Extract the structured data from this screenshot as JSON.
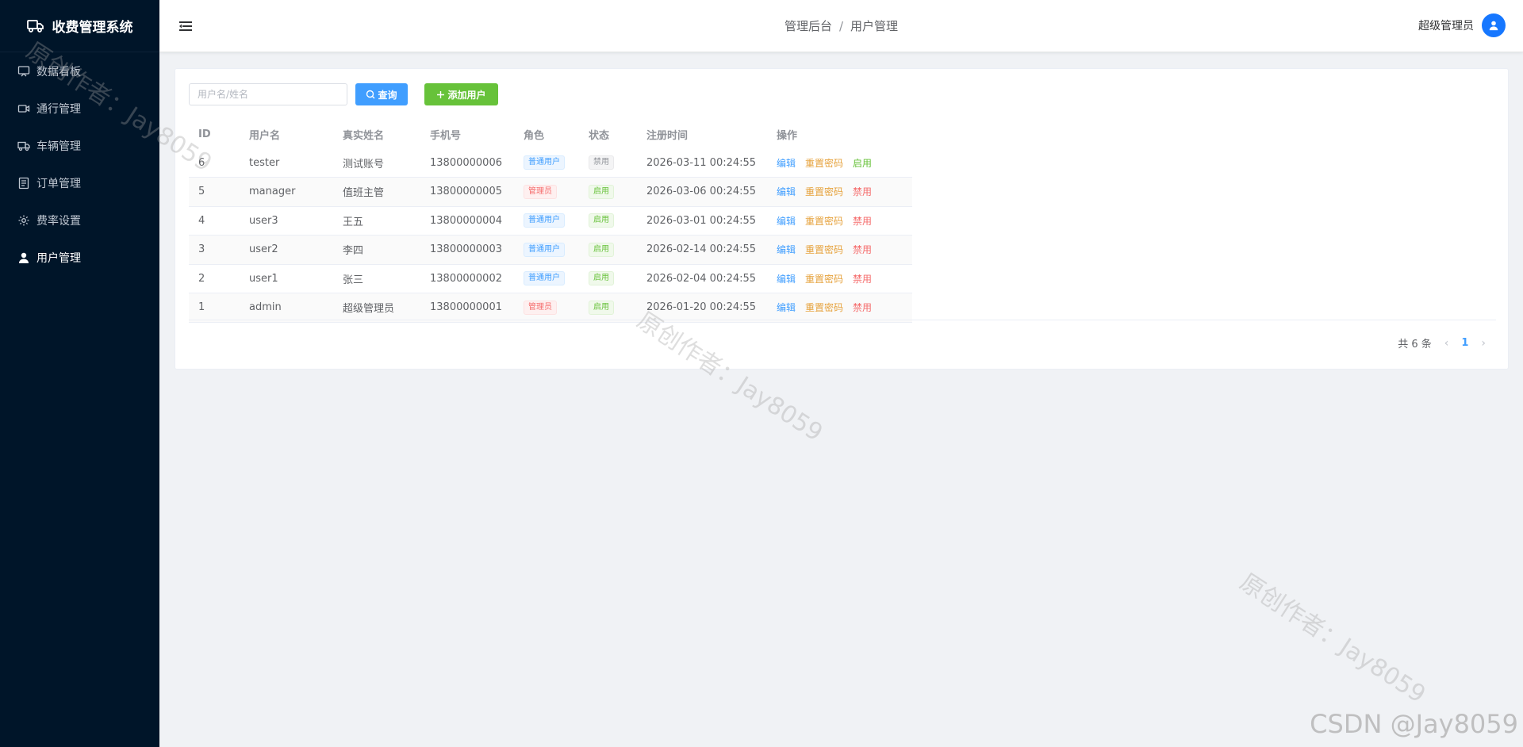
{
  "app": {
    "title": "收费管理系统"
  },
  "sidebar": {
    "items": [
      {
        "label": "数据看板",
        "icon": "dashboard-icon"
      },
      {
        "label": "通行管理",
        "icon": "camera-icon"
      },
      {
        "label": "车辆管理",
        "icon": "truck-icon"
      },
      {
        "label": "订单管理",
        "icon": "document-icon"
      },
      {
        "label": "费率设置",
        "icon": "gear-icon"
      },
      {
        "label": "用户管理",
        "icon": "user-icon",
        "active": true
      }
    ]
  },
  "header": {
    "breadcrumb": [
      "管理后台",
      "用户管理"
    ],
    "breadcrumb_sep": "/",
    "user_name": "超级管理员"
  },
  "toolbar": {
    "search_placeholder": "用户名/姓名",
    "search_value": "",
    "query_label": "查询",
    "add_label": "添加用户"
  },
  "table": {
    "columns": [
      "ID",
      "用户名",
      "真实姓名",
      "手机号",
      "角色",
      "状态",
      "注册时间",
      "操作"
    ],
    "rows": [
      {
        "id": "6",
        "username": "tester",
        "realname": "测试账号",
        "phone": "13800000006",
        "role": "普通用户",
        "status": "禁用",
        "registered": "2026-03-11 00:24:55",
        "toggle": "启用"
      },
      {
        "id": "5",
        "username": "manager",
        "realname": "值班主管",
        "phone": "13800000005",
        "role": "管理员",
        "status": "启用",
        "registered": "2026-03-06 00:24:55",
        "toggle": "禁用"
      },
      {
        "id": "4",
        "username": "user3",
        "realname": "王五",
        "phone": "13800000004",
        "role": "普通用户",
        "status": "启用",
        "registered": "2026-03-01 00:24:55",
        "toggle": "禁用"
      },
      {
        "id": "3",
        "username": "user2",
        "realname": "李四",
        "phone": "13800000003",
        "role": "普通用户",
        "status": "启用",
        "registered": "2026-02-14 00:24:55",
        "toggle": "禁用"
      },
      {
        "id": "2",
        "username": "user1",
        "realname": "张三",
        "phone": "13800000002",
        "role": "普通用户",
        "status": "启用",
        "registered": "2026-02-04 00:24:55",
        "toggle": "禁用"
      },
      {
        "id": "1",
        "username": "admin",
        "realname": "超级管理员",
        "phone": "13800000001",
        "role": "管理员",
        "status": "启用",
        "registered": "2026-01-20 00:24:55",
        "toggle": "禁用"
      }
    ],
    "actions": {
      "edit": "编辑",
      "reset": "重置密码"
    }
  },
  "pagination": {
    "total_text": "共 6 条",
    "current_page": "1"
  },
  "watermarks": {
    "author": "原创作者：Jay8059",
    "csdn": "CSDN @Jay8059"
  },
  "colors": {
    "sidebar_bg": "#001529",
    "primary": "#409eff",
    "success": "#67c23a",
    "warning": "#e6a23c",
    "danger": "#f56c6c"
  }
}
